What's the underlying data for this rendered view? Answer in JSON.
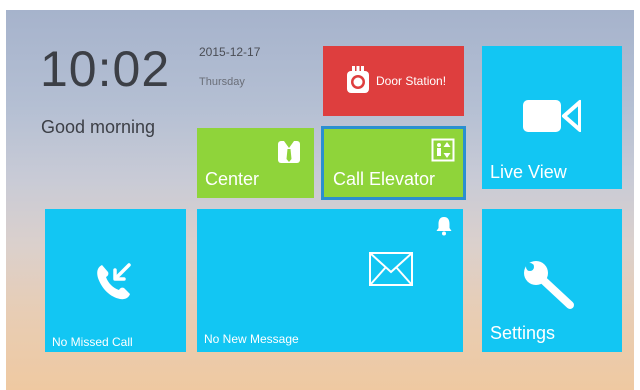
{
  "clock": {
    "time": "10:02",
    "greeting": "Good morning",
    "date": "2015-12-17",
    "weekday": "Thursday"
  },
  "tiles": {
    "door_station": {
      "label": "Door Station!",
      "icon": "camera-icon",
      "color": "#de3e3e"
    },
    "center": {
      "label": "Center",
      "icon": "concierge-icon",
      "color": "#8fd43a"
    },
    "call_elevator": {
      "label": "Call Elevator",
      "icon": "elevator-icon",
      "color": "#8fd43a"
    },
    "live_view": {
      "label": "Live View",
      "icon": "video-camera-icon",
      "color": "#12c6f3"
    },
    "missed_call": {
      "label": "No Missed Call",
      "icon": "missed-call-icon",
      "color": "#12c6f3"
    },
    "message": {
      "label": "No New Message",
      "icon": "envelope-icon",
      "color": "#12c6f3"
    },
    "settings": {
      "label": "Settings",
      "icon": "wrench-icon",
      "color": "#12c6f3"
    }
  }
}
